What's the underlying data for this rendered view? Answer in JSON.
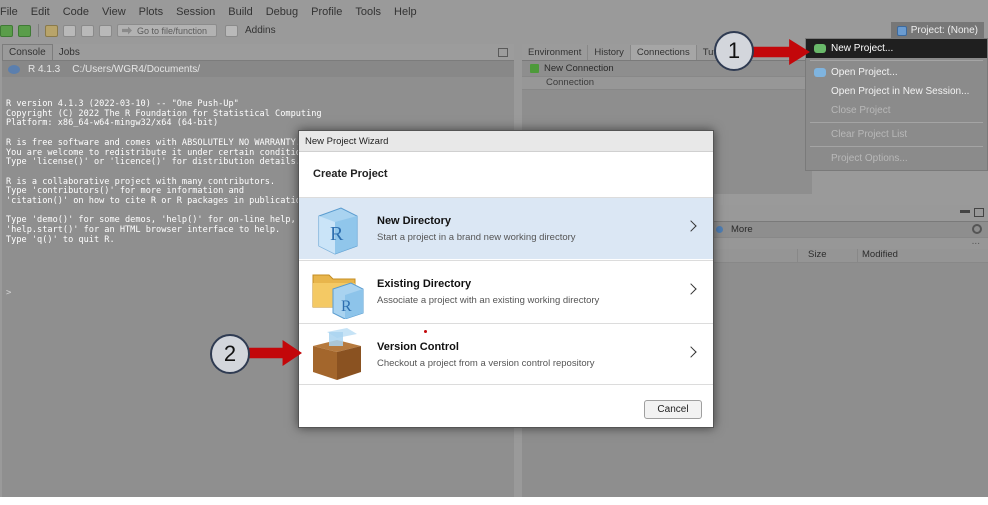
{
  "menubar": {
    "items": [
      "File",
      "Edit",
      "Code",
      "View",
      "Plots",
      "Session",
      "Build",
      "Debug",
      "Profile",
      "Tools",
      "Help"
    ]
  },
  "toolbar": {
    "goto_placeholder": "Go to file/function",
    "addins_label": "Addins",
    "project_label": "Project: (None)"
  },
  "left_pane": {
    "tabs": [
      "Console",
      "Jobs"
    ],
    "r_version": "R 4.1.3",
    "path": "C:/Users/WGR4/Documents/",
    "console_text": "R version 4.1.3 (2022-03-10) -- \"One Push-Up\"\nCopyright (C) 2022 The R Foundation for Statistical Computing\nPlatform: x86_64-w64-mingw32/x64 (64-bit)\n\nR is free software and comes with ABSOLUTELY NO WARRANTY.\nYou are welcome to redistribute it under certain condition\nType 'license()' or 'licence()' for distribution details.\n\nR is a collaborative project with many contributors.\nType 'contributors()' for more information and\n'citation()' on how to cite R or R packages in publication\n\nType 'demo()' for some demos, 'help()' for on-line help, o\n'help.start()' for an HTML browser interface to help.\nType 'q()' to quit R.",
    "prompt": ">"
  },
  "right_top_pane": {
    "tabs": [
      "Environment",
      "History",
      "Connections",
      "Tuto"
    ],
    "new_connection": "New Connection",
    "connection_header": "Connection"
  },
  "right_bottom_pane": {
    "more_label": "More",
    "ellipsis": "...",
    "col_size": "Size",
    "col_modified": "Modified"
  },
  "project_menu": {
    "items": [
      {
        "label": "New Project...",
        "state": "highlight"
      },
      {
        "label": "Open Project...",
        "state": "normal"
      },
      {
        "label": "Open Project in New Session...",
        "state": "normal"
      },
      {
        "label": "Close Project",
        "state": "disabled"
      },
      {
        "label": "Clear Project List",
        "state": "disabled"
      },
      {
        "label": "Project Options...",
        "state": "disabled"
      }
    ]
  },
  "annotations": {
    "badge1": "1",
    "badge2": "2",
    "arrow_color": "#c3070a"
  },
  "dialog": {
    "title": "New Project Wizard",
    "heading": "Create Project",
    "options": [
      {
        "title": "New Directory",
        "desc": "Start a project in a brand new working directory",
        "icon": "r-cube-icon"
      },
      {
        "title": "Existing Directory",
        "desc": "Associate a project with an existing working directory",
        "icon": "folder-r-icon"
      },
      {
        "title": "Version Control",
        "desc": "Checkout a project from a version control repository",
        "icon": "box-icon"
      }
    ],
    "cancel_label": "Cancel"
  }
}
